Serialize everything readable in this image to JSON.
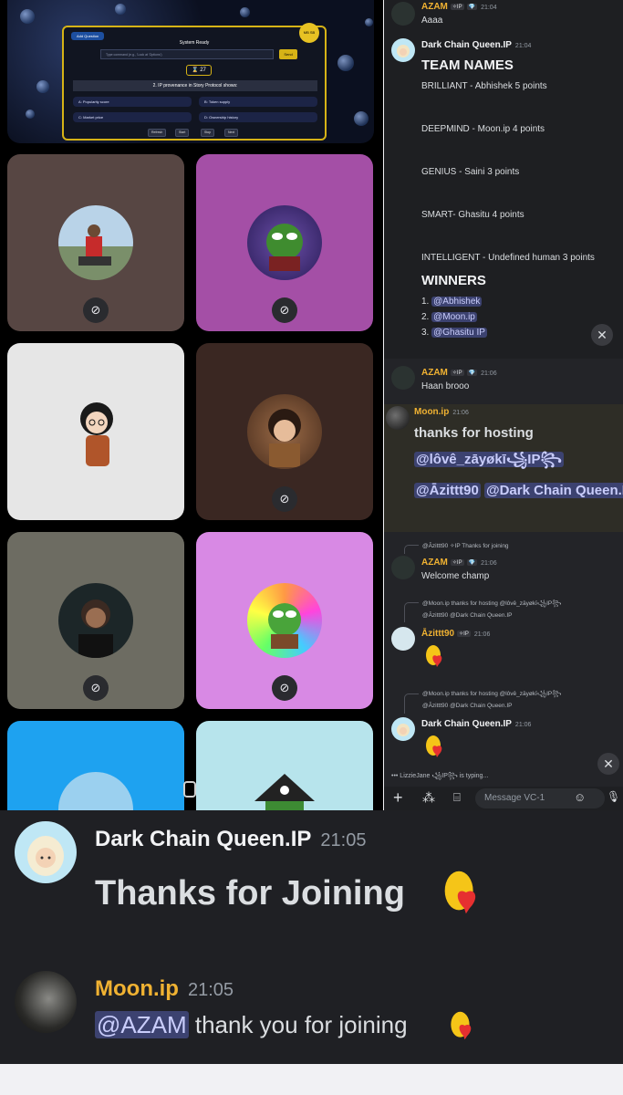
{
  "game": {
    "tag_label": "Add Question",
    "status": "System Ready",
    "command_placeholder": "Type command (e.g., 'Look at 'Options')",
    "send_label": "Send",
    "timer": "27",
    "question": "2. IP provenance in Story Protocol shows:",
    "options": [
      "A: Popularity score",
      "B: Token supply",
      "C: Market price",
      "D: Ownership history"
    ],
    "buttons": [
      "Refresh",
      "Start",
      "Stop",
      "Next"
    ],
    "coin_label": "MB SB"
  },
  "chat_top": {
    "msg1": {
      "author": "AZAM",
      "badge": "IP",
      "time": "21:04",
      "text": "Aaaa"
    },
    "msg2": {
      "author": "Dark Chain Queen.IP",
      "time": "21:04",
      "heading1": "TEAM NAMES",
      "teams": [
        "BRILLIANT -  Abhishek 5 points",
        "DEEPMIND - Moon.ip 4 points",
        "GENIUS - Saini 3 points",
        "SMART- Ghasitu  4 points",
        "INTELLIGENT - Undefined human 3 points"
      ],
      "heading2": "WINNERS",
      "winners": [
        "@Abhishek",
        "@Moon.ip",
        "@Ghasitu IP"
      ]
    }
  },
  "chat_bottom": {
    "msg3": {
      "author": "AZAM",
      "badge": "IP",
      "time": "21:06",
      "text": "Haan brooo"
    },
    "msg4": {
      "author": "Moon.ip",
      "time": "21:06",
      "line1": "thanks for hosting",
      "mention1": "@lôvê_zāyøkī꧁IP꧂",
      "mention2": "@Āzittt90",
      "mention3": "@Dark Chain Queen.IP"
    },
    "msg5": {
      "reply": "@Āzittt90 ✧IP Thanks for joining",
      "author": "AZAM",
      "badge": "IP",
      "time": "21:06",
      "text": "Welcome champ"
    },
    "msg6": {
      "reply_a": "@Moon.ip thanks for hosting @lôvê_zāyøkī꧁IP꧂",
      "reply_b": "@Āzittt90 @Dark Chain Queen.IP",
      "author": "Āzittt90",
      "badge": "IP",
      "time": "21:06"
    },
    "msg7": {
      "reply_a": "@Moon.ip thanks for hosting @lôvê_zāyøkī꧁IP꧂",
      "reply_b": "@Āzittt90 @Dark Chain Queen.IP",
      "author": "Dark Chain Queen.IP",
      "time": "21:06"
    },
    "typing": "LizzieJane ꧁IP꧂ is typing...",
    "composer_placeholder": "Message VC-1"
  },
  "bottom": {
    "msg1": {
      "author": "Dark Chain Queen.IP",
      "time": "21:05",
      "text": "Thanks for Joining"
    },
    "msg2": {
      "author": "Moon.ip",
      "time": "21:05",
      "mention": "@AZAM",
      "text": " thank you for joining"
    }
  },
  "colors": {
    "azam": "#f0b232",
    "moon": "#f0b232",
    "mention_bg": "#3c4270",
    "chat_bg": "#1e1f22"
  }
}
